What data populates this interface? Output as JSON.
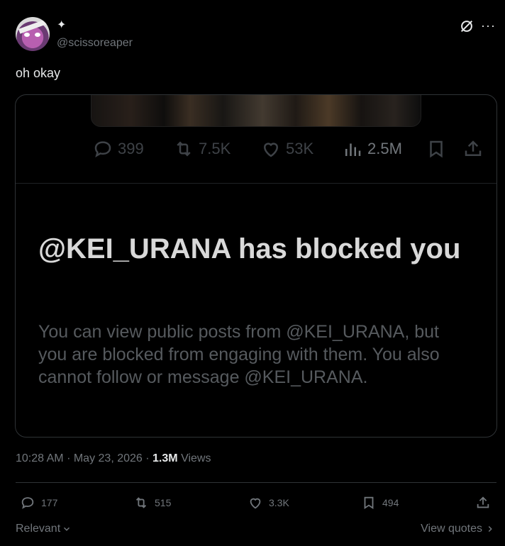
{
  "author": {
    "display_name": "✦",
    "handle": "@scissoreaper"
  },
  "post": {
    "text": "oh okay"
  },
  "quoted_card": {
    "actions": {
      "replies": "399",
      "reposts": "7.5K",
      "likes": "53K",
      "views": "2.5M"
    },
    "block_title": "@KEI_URANA has blocked you",
    "block_description": "You can view public posts from @KEI_URANA, but you are blocked from engaging with them. You also cannot follow or message @KEI_URANA."
  },
  "meta": {
    "time": "10:28 AM",
    "date": "May 23, 2026",
    "views_count": "1.3M",
    "views_label": "Views",
    "sep": "·"
  },
  "actions": {
    "replies": "177",
    "reposts": "515",
    "likes": "3.3K",
    "bookmarks": "494"
  },
  "footer": {
    "sort_label": "Relevant",
    "quotes_link": "View quotes"
  },
  "icons": [
    "grok-icon",
    "more-icon",
    "reply-icon",
    "repost-icon",
    "like-icon",
    "views-icon",
    "bookmark-icon",
    "share-icon",
    "chevron-down-icon",
    "chevron-right-icon"
  ],
  "colors": {
    "background": "#000000",
    "text": "#e7e9ea",
    "muted": "#71767b",
    "border": "#2f3336"
  }
}
